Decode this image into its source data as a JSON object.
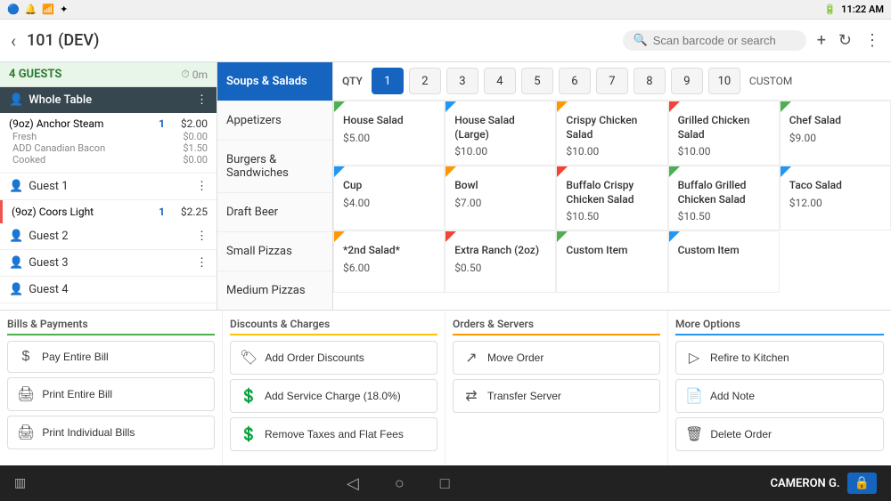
{
  "statusBar": {
    "leftIcons": [
      "bluetooth-icon",
      "notification-icon",
      "wifi-icon",
      "battery-icon"
    ],
    "time": "11:22 AM",
    "wifiStrength": "full",
    "battery": "charging"
  },
  "topBar": {
    "backLabel": "‹",
    "title": "101 (DEV)",
    "searchPlaceholder": "Scan barcode or search",
    "addIcon": "+",
    "refreshIcon": "↻",
    "moreIcon": "⋮"
  },
  "guestsHeader": {
    "label": "4 GUESTS",
    "timer": "0m"
  },
  "wholeTable": {
    "label": "Whole Table"
  },
  "orderItems": [
    {
      "name": "(9oz) Anchor Steam",
      "qty": "1",
      "price": "$2.00"
    },
    {
      "sub1": "Fresh",
      "sub1price": "$0.00"
    },
    {
      "sub2": "ADD Canadian Bacon",
      "sub2price": "$1.50"
    },
    {
      "sub3": "Cooked",
      "sub3price": "$0.00"
    }
  ],
  "guests": [
    {
      "label": "Guest 1"
    },
    {
      "label": "(9oz) Coors Light",
      "qty": "1",
      "price": "$2.25"
    },
    {
      "label": "Guest 2"
    },
    {
      "label": "Guest 3"
    },
    {
      "label": "Guest 4"
    }
  ],
  "categories": [
    {
      "label": "Soups & Salads",
      "active": true
    },
    {
      "label": "Appetizers",
      "active": false
    },
    {
      "label": "Burgers & Sandwiches",
      "active": false
    },
    {
      "label": "Draft Beer",
      "active": false
    },
    {
      "label": "Small Pizzas",
      "active": false
    },
    {
      "label": "Medium Pizzas",
      "active": false
    }
  ],
  "qtyBar": {
    "label": "QTY",
    "buttons": [
      "1",
      "2",
      "3",
      "4",
      "5",
      "6",
      "7",
      "8",
      "9",
      "10"
    ],
    "activeIndex": 0,
    "customLabel": "CUSTOM"
  },
  "menuItems": [
    {
      "name": "House Salad",
      "price": "$5.00",
      "corner": "green"
    },
    {
      "name": "House Salad (Large)",
      "price": "$10.00",
      "corner": "blue"
    },
    {
      "name": "Crispy Chicken Salad",
      "price": "$10.00",
      "corner": "orange"
    },
    {
      "name": "Grilled Chicken Salad",
      "price": "$10.00",
      "corner": "red"
    },
    {
      "name": "Chef Salad",
      "price": "$9.00",
      "corner": "green"
    },
    {
      "name": "Cup",
      "price": "$4.00",
      "corner": "blue"
    },
    {
      "name": "Bowl",
      "price": "$7.00",
      "corner": "orange"
    },
    {
      "name": "Buffalo Crispy Chicken Salad",
      "price": "$10.50",
      "corner": "red"
    },
    {
      "name": "Buffalo Grilled Chicken Salad",
      "price": "$10.50",
      "corner": "green"
    },
    {
      "name": "Taco Salad",
      "price": "$12.00",
      "corner": "blue"
    },
    {
      "name": "*2nd Salad*",
      "price": "$6.00",
      "corner": "orange"
    },
    {
      "name": "Extra Ranch (2oz)",
      "price": "$0.50",
      "corner": "red"
    },
    {
      "name": "Custom Item",
      "price": "",
      "corner": "green"
    },
    {
      "name": "Custom Item",
      "price": "",
      "corner": "blue"
    }
  ],
  "actionSections": {
    "billsPayments": {
      "title": "Bills & Payments",
      "color": "green",
      "buttons": [
        {
          "label": "Pay Entire Bill",
          "icon": "$"
        },
        {
          "label": "Print Entire Bill",
          "icon": "🖨"
        },
        {
          "label": "Print Individual Bills",
          "icon": "🖨"
        }
      ]
    },
    "discountsCharges": {
      "title": "Discounts & Charges",
      "color": "yellow",
      "buttons": [
        {
          "label": "Add Order Discounts",
          "icon": "%"
        },
        {
          "label": "Add Service Charge (18.0%)",
          "icon": "$"
        },
        {
          "label": "Remove Taxes and Flat Fees",
          "icon": "$"
        }
      ]
    },
    "ordersServers": {
      "title": "Orders & Servers",
      "color": "orange",
      "buttons": [
        {
          "label": "Move Order",
          "icon": "↗"
        },
        {
          "label": "Transfer Server",
          "icon": "⇄"
        }
      ]
    },
    "moreOptions": {
      "title": "More Options",
      "color": "blue",
      "buttons": [
        {
          "label": "Refire to Kitchen",
          "icon": "▷"
        },
        {
          "label": "Add Note",
          "icon": "📄"
        },
        {
          "label": "Delete Order",
          "icon": "🗑"
        }
      ]
    }
  },
  "bottomNav": {
    "barcodeIcon": "▥",
    "backIcon": "◁",
    "homeIcon": "○",
    "squareIcon": "□",
    "userName": "CAMERON G.",
    "lockIcon": "🔒"
  }
}
